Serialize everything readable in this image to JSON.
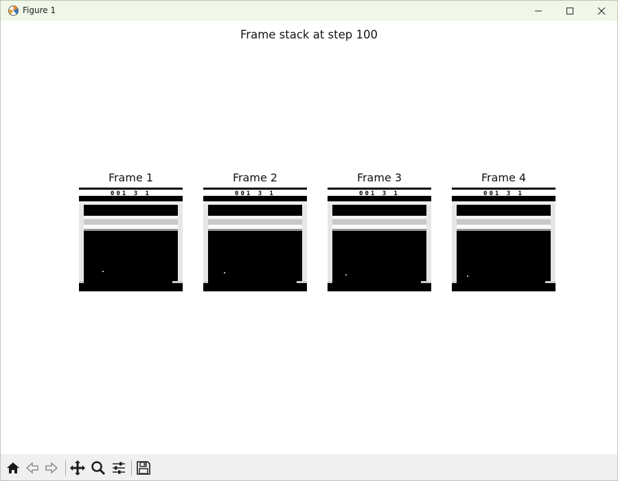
{
  "window": {
    "title": "Figure 1",
    "controls": [
      "minimize-icon",
      "maximize-icon",
      "close-icon"
    ]
  },
  "figure": {
    "title": "Frame stack at step 100",
    "frames": [
      {
        "label": "Frame 1",
        "score_text": "001 3 1"
      },
      {
        "label": "Frame 2",
        "score_text": "001 3 1"
      },
      {
        "label": "Frame 3",
        "score_text": "001 3 1"
      },
      {
        "label": "Frame 4",
        "score_text": "001 3 1"
      }
    ]
  },
  "toolbar": {
    "buttons": [
      "home-icon",
      "back-icon",
      "forward-icon",
      "pan-icon",
      "zoom-icon",
      "configure-subplots-icon",
      "save-icon"
    ]
  },
  "colors": {
    "titlebar_bg": "#f0f6e8",
    "toolbar_bg": "#f0f0f0",
    "frame_black": "#000000",
    "frame_white": "#ffffff"
  }
}
